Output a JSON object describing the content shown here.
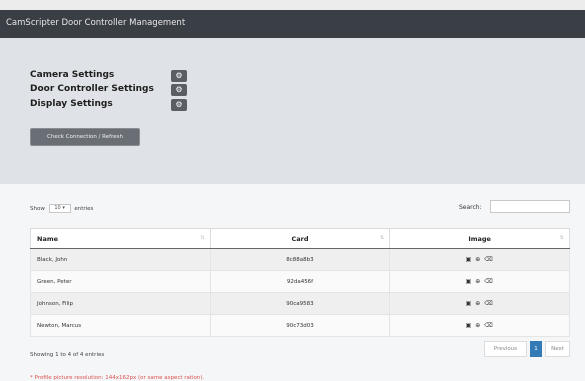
{
  "header": {
    "title": "CamScripter Door Controller Management"
  },
  "settings": {
    "items": [
      {
        "label": "Camera Settings",
        "icon": "gear-icon"
      },
      {
        "label": "Door Controller Settings",
        "icon": "gear-icon"
      },
      {
        "label": "Display Settings",
        "icon": "gear-icon"
      }
    ],
    "refresh_label": "Check Connection / Refresh"
  },
  "table_controls": {
    "show_label": "Show",
    "entries_value": "10",
    "entries_label": "entries",
    "search_label": "Search:",
    "search_value": ""
  },
  "table": {
    "columns": [
      "Name",
      "Card",
      "Image"
    ],
    "rows": [
      {
        "name": "Black, John",
        "card": "8c88a8b3"
      },
      {
        "name": "Green, Peter",
        "card": "92da456f"
      },
      {
        "name": "Johnson, Filip",
        "card": "90ca9583"
      },
      {
        "name": "Newton, Marcus",
        "card": "90c73d03"
      }
    ],
    "row_icons": [
      "image-icon",
      "upload-icon",
      "trash-icon"
    ]
  },
  "footer": {
    "info": "Showing 1 to 4 of 4 entries",
    "pagination": {
      "previous": "Previous",
      "current": "1",
      "next": "Next"
    },
    "note": "* Profile picture resolution: 144x162px (or same aspect ration)."
  },
  "colors": {
    "header_bg": "#3a3e45",
    "panel_bg": "#dfe2e6",
    "accent": "#337ab7",
    "note": "#d9534f"
  }
}
